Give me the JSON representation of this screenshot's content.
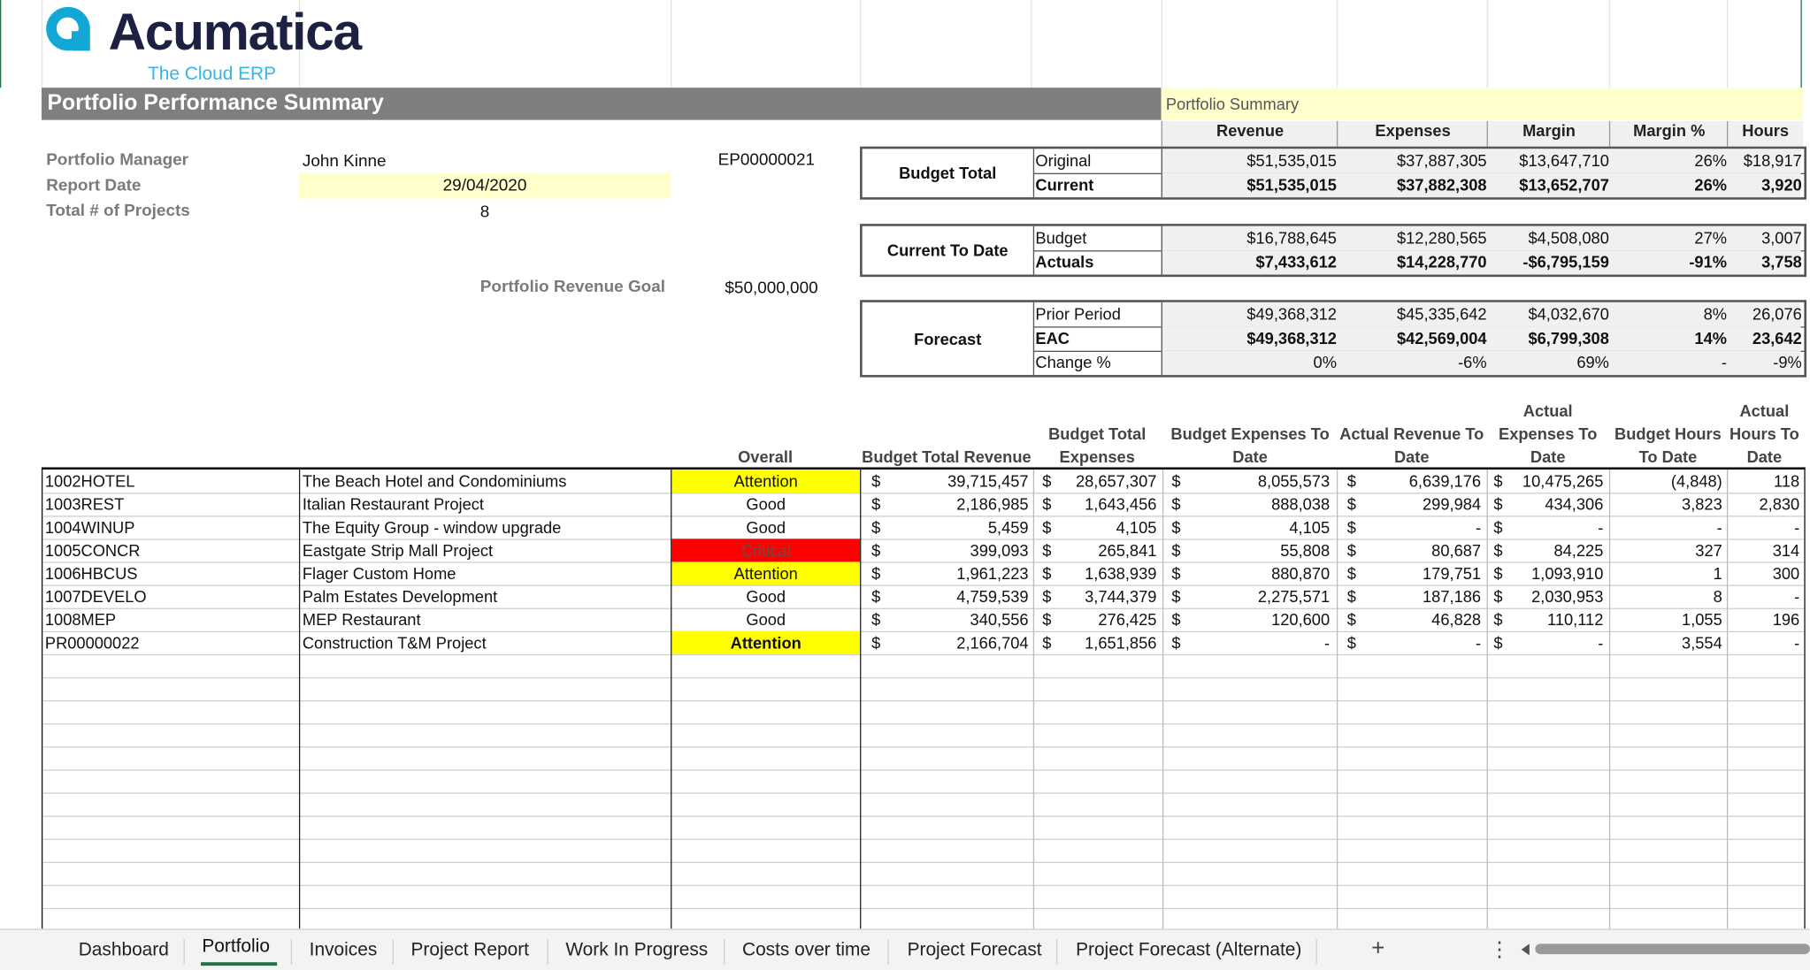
{
  "logo": {
    "name": "Acumatica",
    "tagline": "The Cloud ERP"
  },
  "title": "Portfolio Performance Summary",
  "portfolio_summary_label": "Portfolio Summary",
  "info": {
    "manager_label": "Portfolio Manager",
    "manager": "John Kinne",
    "date_label": "Report Date",
    "date": "29/04/2020",
    "projects_label": "Total # of Projects",
    "projects": "8",
    "portfolio_id": "EP00000021",
    "goal_label": "Portfolio Revenue Goal",
    "goal": "$50,000,000"
  },
  "summary_columns": [
    "Revenue",
    "Expenses",
    "Margin",
    "Margin %",
    "Hours"
  ],
  "summary_groups": [
    {
      "label": "Budget Total",
      "rows": [
        {
          "label": "Original",
          "values": [
            "$51,535,015",
            "$37,887,305",
            "$13,647,710",
            "26%",
            "$18,917"
          ]
        },
        {
          "label": "Current",
          "values": [
            "$51,535,015",
            "$37,882,308",
            "$13,652,707",
            "26%",
            "3,920"
          ]
        }
      ]
    },
    {
      "label": "Current To Date",
      "rows": [
        {
          "label": "Budget",
          "values": [
            "$16,788,645",
            "$12,280,565",
            "$4,508,080",
            "27%",
            "3,007"
          ]
        },
        {
          "label": "Actuals",
          "values": [
            "$7,433,612",
            "$14,228,770",
            "-$6,795,159",
            "-91%",
            "3,758"
          ]
        }
      ]
    },
    {
      "label": "Forecast",
      "rows": [
        {
          "label": "Prior Period",
          "values": [
            "$49,368,312",
            "$45,335,642",
            "$4,032,670",
            "8%",
            "26,076"
          ]
        },
        {
          "label": "EAC",
          "values": [
            "$49,368,312",
            "$42,569,004",
            "$6,799,308",
            "14%",
            "23,642"
          ]
        },
        {
          "label": "Change %",
          "values": [
            "0%",
            "-6%",
            "69%",
            "-",
            "-9%"
          ]
        }
      ]
    }
  ],
  "table_headers": {
    "overall": "Overall",
    "budget_total_revenue": "Budget Total Revenue",
    "budget_total_expenses": [
      "Budget Total",
      "Expenses"
    ],
    "budget_expenses_to_date": [
      "Budget Expenses To",
      "Date"
    ],
    "actual_revenue_to_date": [
      "Actual Revenue To",
      "Date"
    ],
    "actual_expenses_to_date": [
      "Actual",
      "Expenses To",
      "Date"
    ],
    "budget_hours_to_date": [
      "Budget Hours",
      "To Date"
    ],
    "actual_hours_to_date": [
      "Actual",
      "Hours To",
      "Date"
    ]
  },
  "currency_symbol": "$",
  "projects": [
    {
      "id": "1002HOTEL",
      "name": "The Beach Hotel and Condominiums",
      "status": "Attention",
      "btr": "39,715,457",
      "bte": "28,657,307",
      "betd": "8,055,573",
      "artd": "6,639,176",
      "aetd": "10,475,265",
      "bhtd": "(4,848)",
      "ahtd": "118"
    },
    {
      "id": "1003REST",
      "name": "Italian Restaurant Project",
      "status": "Good",
      "btr": "2,186,985",
      "bte": "1,643,456",
      "betd": "888,038",
      "artd": "299,984",
      "aetd": "434,306",
      "bhtd": "3,823",
      "ahtd": "2,830"
    },
    {
      "id": "1004WINUP",
      "name": "The Equity Group - window upgrade",
      "status": "Good",
      "btr": "5,459",
      "bte": "4,105",
      "betd": "4,105",
      "artd": "-",
      "aetd": "-",
      "bhtd": "-",
      "ahtd": "-"
    },
    {
      "id": "1005CONCR",
      "name": "Eastgate Strip Mall Project",
      "status": "Critical",
      "btr": "399,093",
      "bte": "265,841",
      "betd": "55,808",
      "artd": "80,687",
      "aetd": "84,225",
      "bhtd": "327",
      "ahtd": "314"
    },
    {
      "id": "1006HBCUS",
      "name": "Flager Custom Home",
      "status": "Attention",
      "btr": "1,961,223",
      "bte": "1,638,939",
      "betd": "880,870",
      "artd": "179,751",
      "aetd": "1,093,910",
      "bhtd": "1",
      "ahtd": "300"
    },
    {
      "id": "1007DEVELO",
      "name": "Palm Estates Development",
      "status": "Good",
      "btr": "4,759,539",
      "bte": "3,744,379",
      "betd": "2,275,571",
      "artd": "187,186",
      "aetd": "2,030,953",
      "bhtd": "8",
      "ahtd": "-"
    },
    {
      "id": "1008MEP",
      "name": "MEP Restaurant",
      "status": "Good",
      "btr": "340,556",
      "bte": "276,425",
      "betd": "120,600",
      "artd": "46,828",
      "aetd": "110,112",
      "bhtd": "1,055",
      "ahtd": "196"
    },
    {
      "id": "PR00000022",
      "name": "Construction T&M Project",
      "status": "Attention",
      "btr": "2,166,704",
      "bte": "1,651,856",
      "betd": "-",
      "artd": "-",
      "aetd": "-",
      "bhtd": "3,554",
      "ahtd": "-"
    }
  ],
  "sheet_tabs": [
    "Dashboard",
    "Portfolio",
    "Invoices",
    "Project Report",
    "Work In Progress",
    "Costs over time",
    "Project Forecast",
    "Project Forecast (Alternate)"
  ],
  "active_tab": "Portfolio",
  "add_sheet_symbol": "+",
  "more_symbol": "⋮",
  "colors": {
    "attention": "#ffff00",
    "critical": "#ff0000",
    "accent": "#217346",
    "brand": "#13a7d6"
  }
}
